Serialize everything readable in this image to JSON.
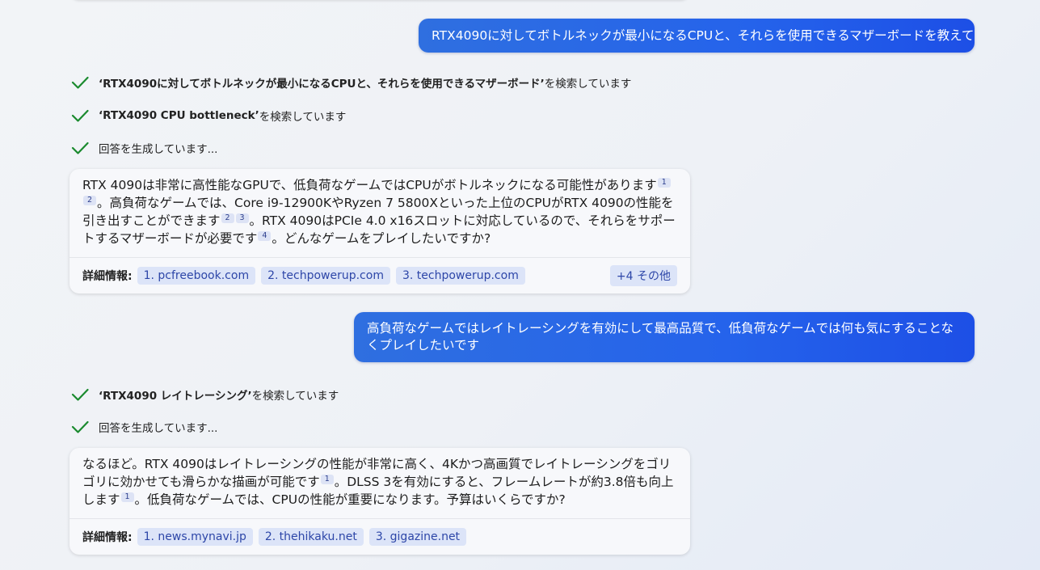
{
  "conversation": {
    "user_msg_1": "RTX4090に対してボトルネックが最小になるCPUと、それらを使用できるマザーボードを教えて",
    "steps_1": [
      {
        "query": "‘RTX4090に対してボトルネックが最小になるCPUと、それらを使用できるマザーボード’",
        "suffix": " を検索しています"
      },
      {
        "query": "‘RTX4090 CPU bottleneck’",
        "suffix": " を検索しています"
      },
      {
        "query": "",
        "suffix": "回答を生成しています..."
      }
    ],
    "answer_1": {
      "p1": "RTX 4090は非常に高性能なGPUで、低負荷なゲームではCPUがボトルネックになる可能性があります",
      "c1": "1",
      "c2": "2",
      "p2": "。高負荷なゲームでは、Core i9-12900KやRyzen 7 5800Xといった上位のCPUがRTX 4090の性能を引き出すことができます",
      "c3": "2",
      "c4": "3",
      "p3": "。RTX 4090はPCIe 4.0 x16スロットに対応しているので、それらをサポートするマザーボードが必要です",
      "c5": "4",
      "p4": "。どんなゲームをプレイしたいですか?",
      "refs_label": "詳細情報:",
      "refs": [
        "1. pcfreebook.com",
        "2. techpowerup.com",
        "3. techpowerup.com"
      ],
      "more": "+4 その他"
    },
    "user_msg_2": "高負荷なゲームではレイトレーシングを有効にして最高品質で、低負荷なゲームでは何も気にすることなくプレイしたいです",
    "steps_2": [
      {
        "query": "‘RTX4090 レイトレーシング’",
        "suffix": " を検索しています"
      },
      {
        "query": "",
        "suffix": "回答を生成しています..."
      }
    ],
    "answer_2": {
      "p1": "なるほど。RTX 4090はレイトレーシングの性能が非常に高く、4Kかつ高画質でレイトレーシングをゴリゴリに効かせても滑らかな描画が可能です",
      "c1": "1",
      "p2": "。DLSS 3を有効にすると、フレームレートが約3.8倍も向上します",
      "c2": "1",
      "p3": "。低負荷なゲームでは、CPUの性能が重要になります。予算はいくらですか?",
      "refs_label": "詳細情報:",
      "refs": [
        "1. news.mynavi.jp",
        "2. thehikaku.net",
        "3. gigazine.net"
      ]
    }
  },
  "colors": {
    "user_bubble": "#2563eb",
    "check": "#1a8a2e",
    "chip_bg": "#dce4f8",
    "chip_text": "#2d46a8"
  }
}
